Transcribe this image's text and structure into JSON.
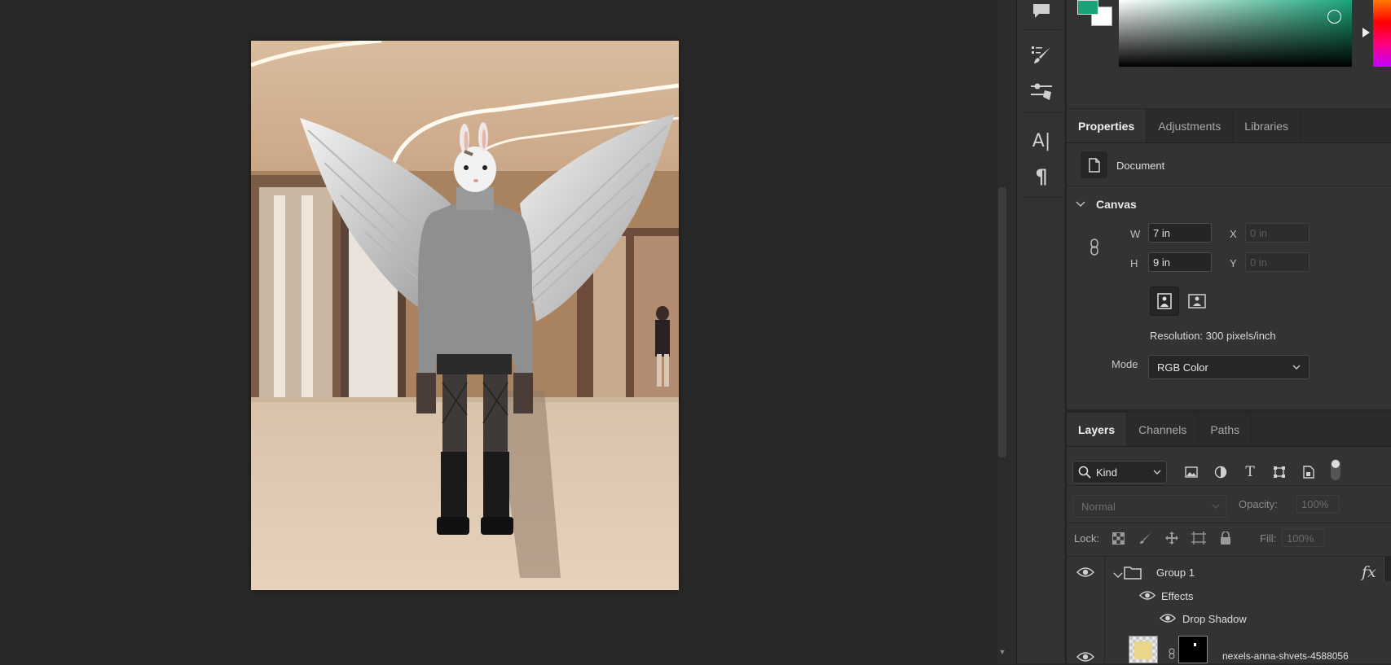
{
  "canvas": {
    "image_alt": "Composite: rabbit-headed figure with angel wings in a shopping mall"
  },
  "toolbar": {
    "icons": [
      "comment-icon",
      "brush-presets-icon",
      "adjust-sliders-icon",
      "character-icon",
      "paragraph-icon"
    ]
  },
  "color": {
    "foreground": "#19a37a",
    "background": "#ffffff"
  },
  "properties_panel": {
    "tabs": [
      {
        "label": "Properties",
        "active": true
      },
      {
        "label": "Adjustments",
        "active": false
      },
      {
        "label": "Libraries",
        "active": false
      }
    ],
    "document_label": "Document",
    "canvas_section": "Canvas",
    "w_label": "W",
    "w_value": "7 in",
    "h_label": "H",
    "h_value": "9 in",
    "x_label": "X",
    "x_value": "0 in",
    "y_label": "Y",
    "y_value": "0 in",
    "resolution": "Resolution: 300 pixels/inch",
    "mode_label": "Mode",
    "mode_value": "RGB Color"
  },
  "layers_panel": {
    "tabs": [
      {
        "label": "Layers",
        "active": true
      },
      {
        "label": "Channels",
        "active": false
      },
      {
        "label": "Paths",
        "active": false
      }
    ],
    "filter_kind": "Kind",
    "blend_mode": "Normal",
    "opacity_label": "Opacity:",
    "opacity_value": "100%",
    "lock_label": "Lock:",
    "fill_label": "Fill:",
    "fill_value": "100%",
    "fx_badge": "fx",
    "layers": [
      {
        "name": "Group 1"
      },
      {
        "name": "Effects"
      },
      {
        "name": "Drop Shadow"
      },
      {
        "name": "nexels-anna-shvets-4588056"
      }
    ]
  }
}
